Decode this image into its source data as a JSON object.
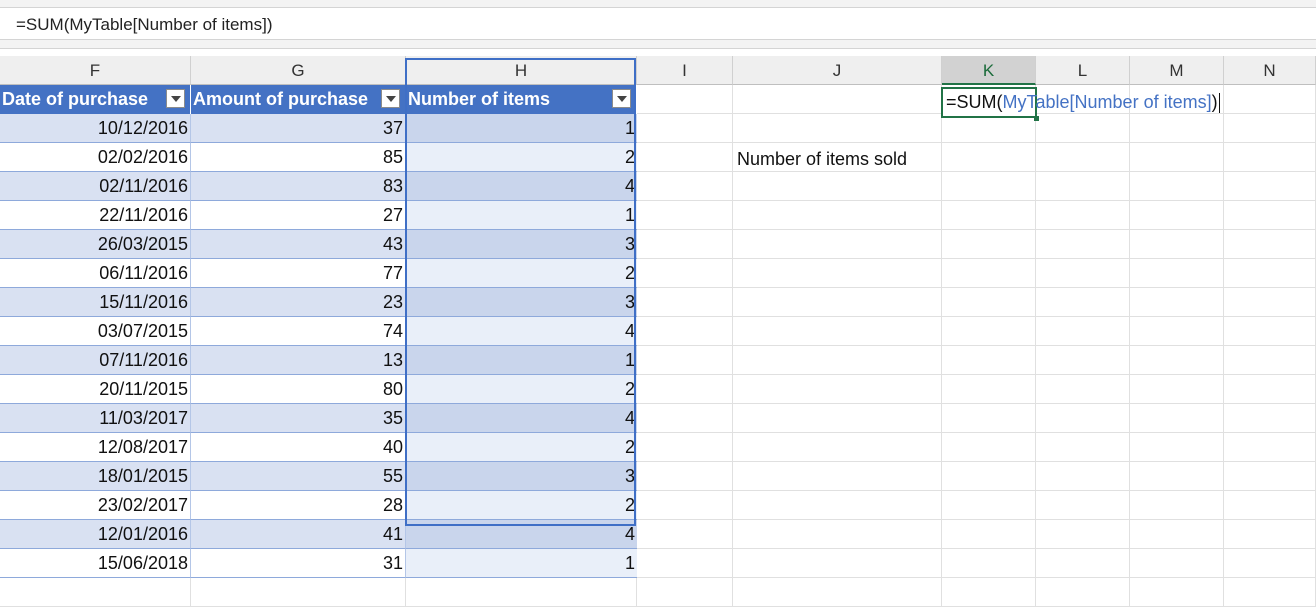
{
  "formula_bar": {
    "content": "=SUM(MyTable[Number of items])"
  },
  "columns": [
    "F",
    "G",
    "H",
    "I",
    "J",
    "K",
    "L",
    "M",
    "N"
  ],
  "selected_column": "K",
  "table": {
    "name": "MyTable",
    "headers": [
      "Date of purchase",
      "Amount of purchase",
      "Number of items"
    ],
    "rows": [
      [
        "10/12/2016",
        "37",
        "1"
      ],
      [
        "02/02/2016",
        "85",
        "2"
      ],
      [
        "02/11/2016",
        "83",
        "4"
      ],
      [
        "22/11/2016",
        "27",
        "1"
      ],
      [
        "26/03/2015",
        "43",
        "3"
      ],
      [
        "06/11/2016",
        "77",
        "2"
      ],
      [
        "15/11/2016",
        "23",
        "3"
      ],
      [
        "03/07/2015",
        "74",
        "4"
      ],
      [
        "07/11/2016",
        "13",
        "1"
      ],
      [
        "20/11/2015",
        "80",
        "2"
      ],
      [
        "11/03/2017",
        "35",
        "4"
      ],
      [
        "12/08/2017",
        "40",
        "2"
      ],
      [
        "18/01/2015",
        "55",
        "3"
      ],
      [
        "23/02/2017",
        "28",
        "2"
      ],
      [
        "12/01/2016",
        "41",
        "4"
      ],
      [
        "15/06/2018",
        "31",
        "1"
      ]
    ]
  },
  "label_cell": {
    "text": "Number of items sold"
  },
  "edit_cell": {
    "func": "=SUM(",
    "ref": "MyTable[Number of items]",
    "close": ")"
  },
  "colors": {
    "table_header": "#4472c4",
    "band": "#d9e1f2",
    "selected_accent": "#217346",
    "reference": "#4472c4"
  }
}
